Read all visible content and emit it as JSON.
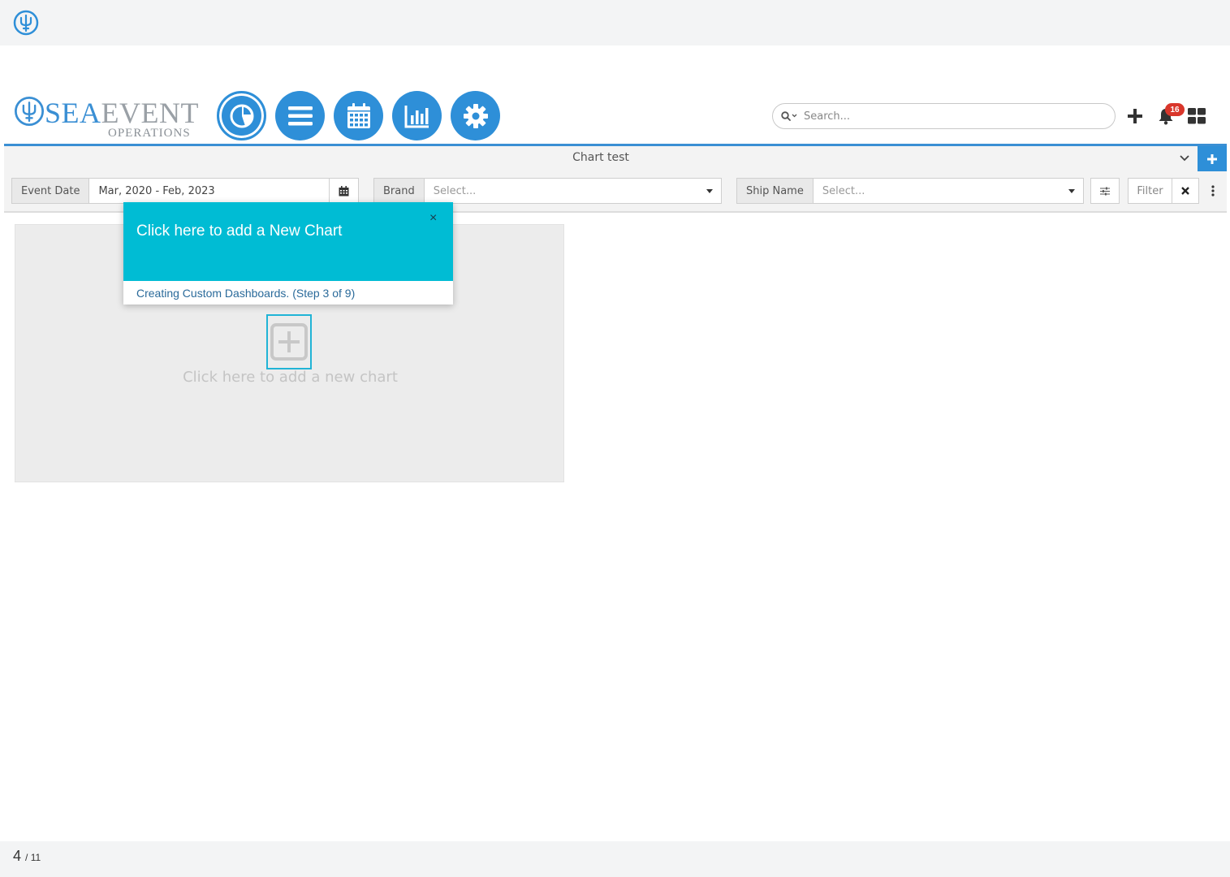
{
  "app": {
    "brand_main": "SEA",
    "brand_event": "EVENT",
    "brand_sub": "OPERATIONS"
  },
  "nav": [
    {
      "icon": "pie-chart-icon",
      "active": true
    },
    {
      "icon": "list-icon",
      "active": false
    },
    {
      "icon": "calendar-icon",
      "active": false
    },
    {
      "icon": "bar-chart-icon",
      "active": false
    },
    {
      "icon": "gear-icon",
      "active": false
    }
  ],
  "search": {
    "placeholder": "Search..."
  },
  "notifications": {
    "count": "16"
  },
  "dashboard": {
    "title": "Chart test"
  },
  "filters": {
    "event_date": {
      "label": "Event Date",
      "value": "Mar, 2020 - Feb, 2023"
    },
    "brand": {
      "label": "Brand",
      "placeholder": "Select..."
    },
    "ship_name": {
      "label": "Ship Name",
      "placeholder": "Select..."
    },
    "filter_button": "Filter"
  },
  "chart_placeholder": {
    "text": "Click here to add a new chart"
  },
  "tour": {
    "title": "Click here to add a New Chart",
    "close": "×",
    "step": "Creating Custom Dashboards. (Step 3 of 9)"
  },
  "pager": {
    "current": "4",
    "total": "/ 11"
  },
  "colors": {
    "primary": "#2e8fd8",
    "tour": "#00bcd4",
    "badge": "#d9362b"
  }
}
